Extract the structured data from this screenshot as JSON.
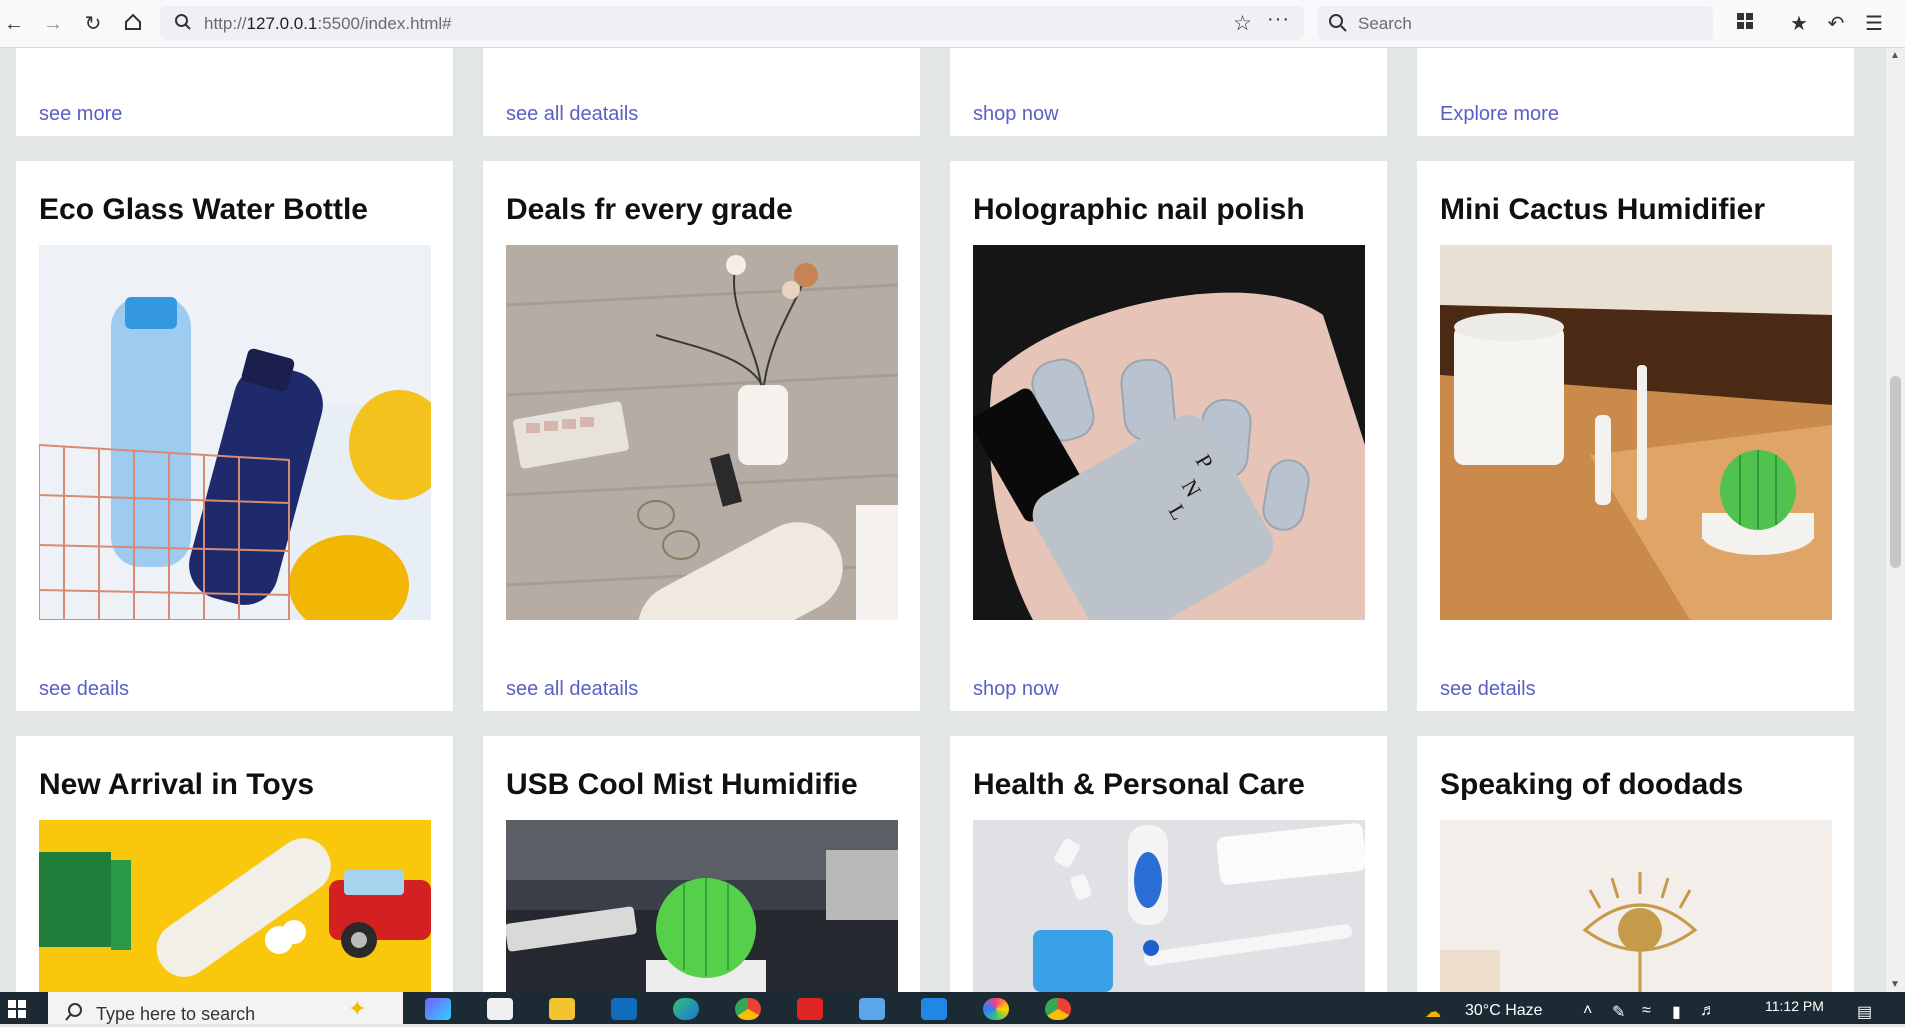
{
  "browser": {
    "url_prefix": "http://",
    "url_host": "127.0.0.1",
    "url_rest": ":5500/index.html#",
    "search_placeholder": "Search"
  },
  "row_top": {
    "links": [
      "see more",
      "see all deatails",
      "shop now",
      "Explore more"
    ]
  },
  "row_middle": [
    {
      "title": "Eco Glass Water Bottle",
      "link": "see deails"
    },
    {
      "title": "Deals fr every grade",
      "link": "see all deatails"
    },
    {
      "title": "Holographic nail polish",
      "link": "shop now"
    },
    {
      "title": "Mini Cactus Humidifier",
      "link": "see details"
    }
  ],
  "row_bottom": [
    {
      "title": "New Arrival in Toys"
    },
    {
      "title": "USB Cool Mist Humidifie"
    },
    {
      "title": "Health & Personal Care"
    },
    {
      "title": "Speaking of doodads"
    }
  ],
  "taskbar": {
    "search_placeholder": "Type here to search",
    "weather": "30°C  Haze",
    "time": "11:12 PM"
  },
  "colors": {
    "link": "#5a5ec7",
    "background": "#e3e6e6",
    "taskbar": "#1c2b33"
  }
}
